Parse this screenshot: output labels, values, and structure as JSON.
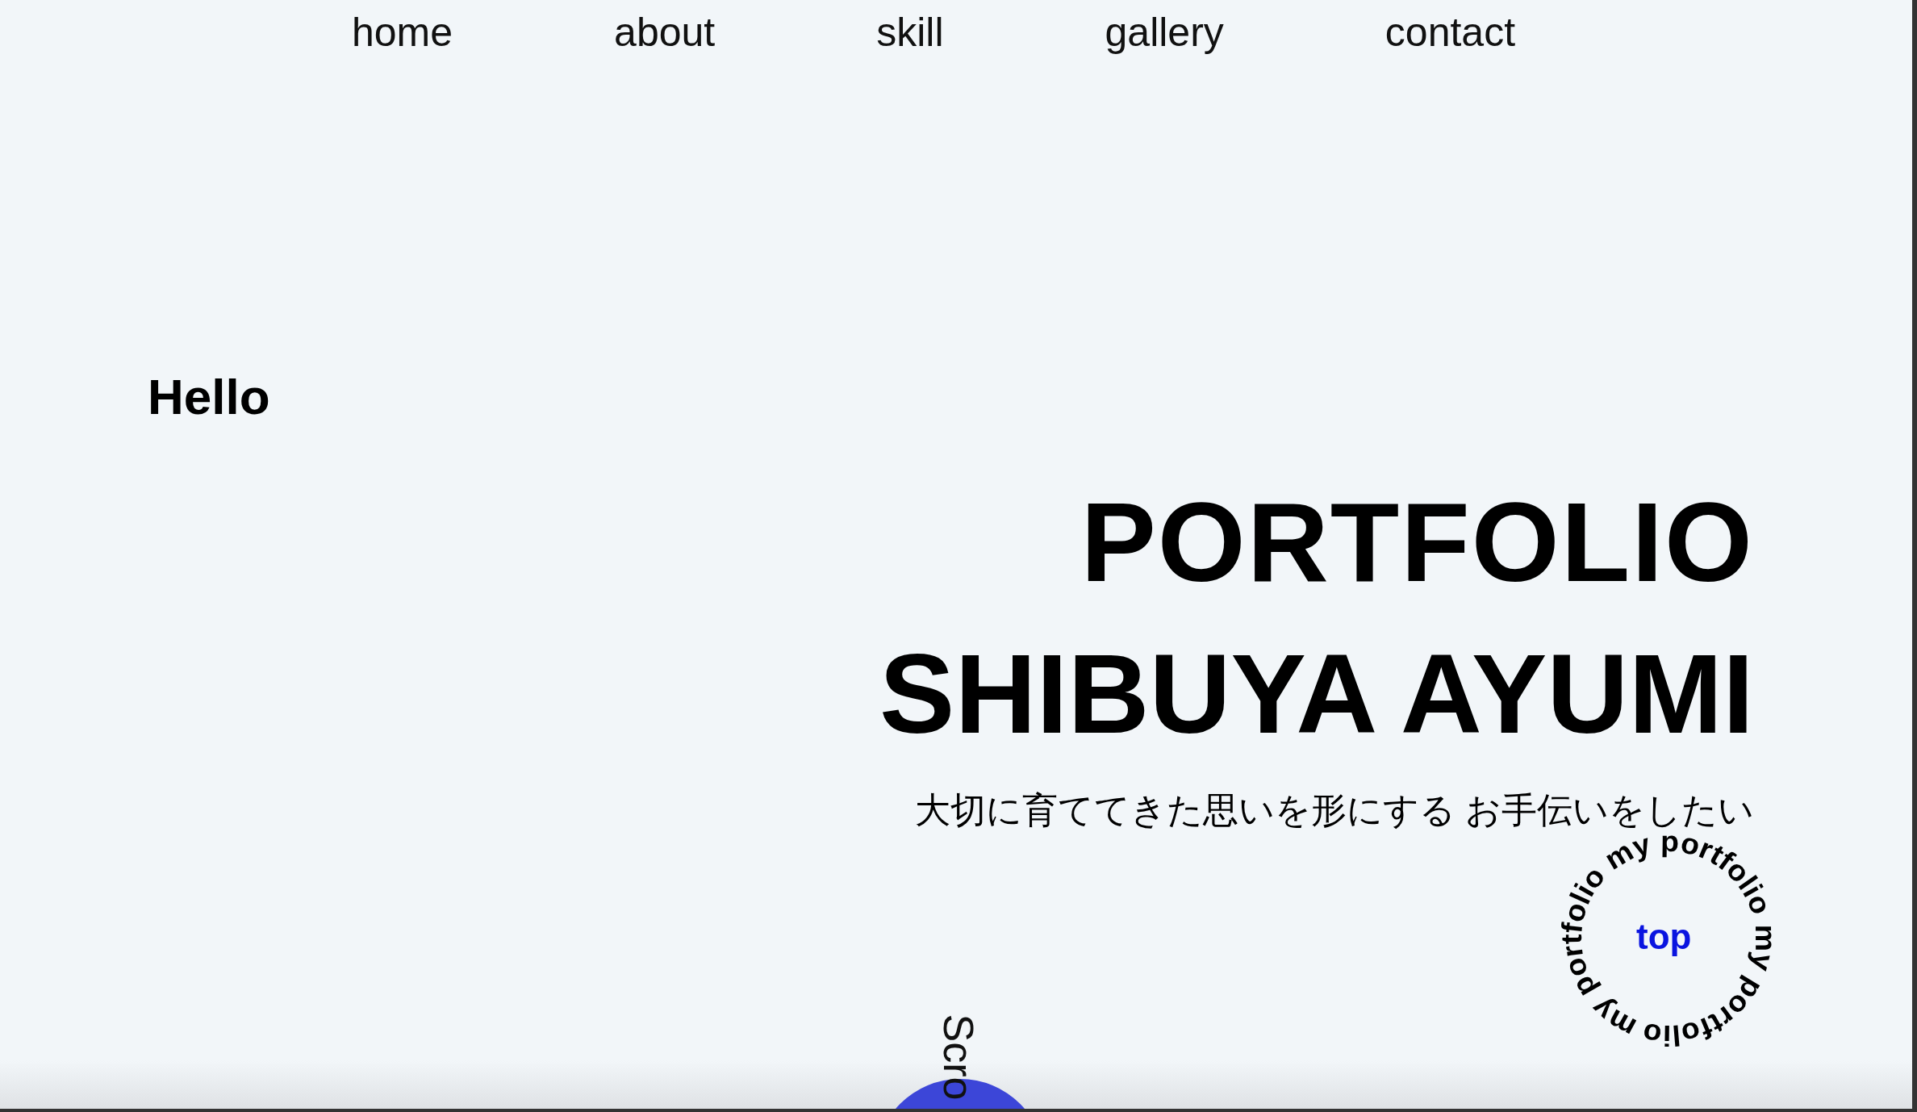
{
  "nav": [
    {
      "label": "home"
    },
    {
      "label": "about"
    },
    {
      "label": "skill"
    },
    {
      "label": "gallery"
    },
    {
      "label": "contact"
    }
  ],
  "greeting": "Hello",
  "title": "PORTFOLIO",
  "name": "SHIBUYA AYUMI",
  "tagline": "大切に育ててきた思いを形にする お手伝いをしたい",
  "top_badge": {
    "ring_text": "my portfolio my portfolio my portfolio ",
    "label": "top"
  },
  "scroll_label": "Scro"
}
